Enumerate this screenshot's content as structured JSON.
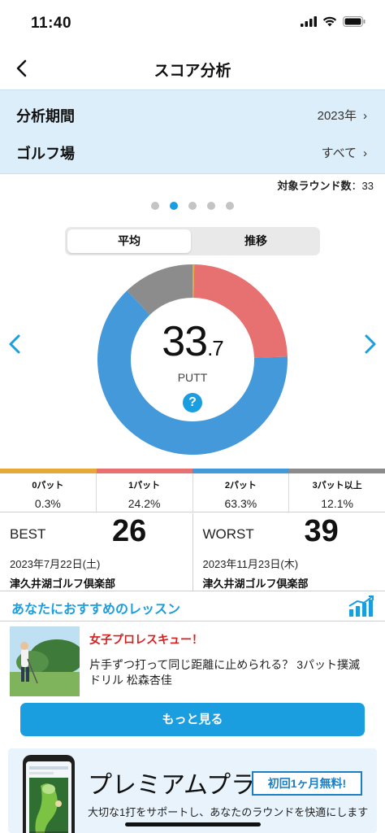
{
  "status_bar": {
    "time": "11:40"
  },
  "nav": {
    "title": "スコア分析"
  },
  "filters": [
    {
      "label": "分析期間",
      "value": "2023年"
    },
    {
      "label": "ゴルフ場",
      "value": "すべて"
    }
  ],
  "rounds": {
    "label": "対象ラウンド数",
    "value": "：33"
  },
  "pager": {
    "count": 5,
    "active_index": 1
  },
  "segments": {
    "left": "平均",
    "right": "推移",
    "selected": "平均"
  },
  "summary": {
    "value_int": "33",
    "value_dec": ".7",
    "unit": "PUTT"
  },
  "chart_data": {
    "type": "pie",
    "categories": [
      "0パット",
      "1パット",
      "2パット",
      "3パット以上"
    ],
    "values": [
      0.3,
      24.2,
      63.3,
      12.1
    ],
    "value_labels": [
      "0.3%",
      "24.2%",
      "63.3%",
      "12.1%"
    ],
    "colors": [
      "#e6a838",
      "#e77170",
      "#4499da",
      "#8c8c8c"
    ],
    "style": "donut"
  },
  "best": {
    "label": "BEST",
    "score": "26",
    "date": "2023年7月22日(土)",
    "course": "津久井湖ゴルフ倶楽部"
  },
  "worst": {
    "label": "WORST",
    "score": "39",
    "date": "2023年11月23日(木)",
    "course": "津久井湖ゴルフ倶楽部"
  },
  "lessons": {
    "title": "あなたにおすすめのレッスン",
    "item": {
      "tag": "女子プロレスキュー！",
      "description": "片手ずつ打って同じ距離に止められる？ 3パット撲滅ドリル 松森杏佳"
    },
    "more_label": "もっと見る"
  },
  "premium": {
    "title": "プレミアムプラン",
    "badge": "初回1ヶ月無料!",
    "description": "大切な1打をサポートし、あなたのラウンドを快適にします"
  },
  "colors": {
    "accent": "#1a9ee0",
    "panel_bg": "#dceef9",
    "tag_red": "#d81d1d"
  }
}
